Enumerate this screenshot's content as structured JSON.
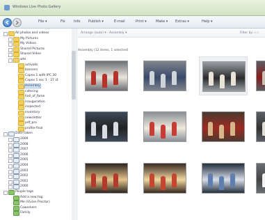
{
  "window": {
    "title": "Windows Live Photo Gallery"
  },
  "toolbar": {
    "items": [
      "File ▾",
      "Fix",
      "Info",
      "Publish ▾",
      "E-mail",
      "Print ▾",
      "Make ▾",
      "Extras ▾",
      "Help ▾"
    ]
  },
  "sidebar": {
    "items": [
      {
        "label": "All photos and videos",
        "icon": "folder-icon"
      },
      {
        "label": "My Pictures",
        "icon": "folder-icon"
      },
      {
        "label": "My Videos",
        "icon": "folder-icon"
      },
      {
        "label": "Shared Pictures",
        "icon": "folder-icon"
      },
      {
        "label": "Shared Video",
        "icon": "folder-icon"
      },
      {
        "label": "wte",
        "icon": "folder-icon"
      },
      {
        "label": "activate",
        "icon": "folder-icon"
      },
      {
        "label": "banners",
        "icon": "folder-icon"
      },
      {
        "label": "Capex 1 with IPC 30",
        "icon": "folder-icon"
      },
      {
        "label": "Capex 1 sec 1 - 27 st",
        "icon": "folder-icon"
      },
      {
        "label": "Assembly",
        "icon": "folder-icon"
      },
      {
        "label": "catering",
        "icon": "folder-icon"
      },
      {
        "label": "hall_of_fame",
        "icon": "folder-icon"
      },
      {
        "label": "inauguration",
        "icon": "folder-icon"
      },
      {
        "label": "inspected",
        "icon": "folder-icon"
      },
      {
        "label": "inventory",
        "icon": "folder-icon"
      },
      {
        "label": "newsletter",
        "icon": "folder-icon"
      },
      {
        "label": "pdf_pro",
        "icon": "folder-icon"
      },
      {
        "label": "profile-final",
        "icon": "folder-icon"
      },
      {
        "label": "Date taken",
        "icon": "calendar-icon"
      },
      {
        "label": "2009",
        "icon": "calendar-icon"
      },
      {
        "label": "2008",
        "icon": "calendar-icon"
      },
      {
        "label": "2007",
        "icon": "calendar-icon"
      },
      {
        "label": "2006",
        "icon": "calendar-icon"
      },
      {
        "label": "2005",
        "icon": "calendar-icon"
      },
      {
        "label": "2004",
        "icon": "calendar-icon"
      },
      {
        "label": "2003",
        "icon": "calendar-icon"
      },
      {
        "label": "2002",
        "icon": "calendar-icon"
      },
      {
        "label": "2001",
        "icon": "calendar-icon"
      },
      {
        "label": "2000",
        "icon": "calendar-icon"
      },
      {
        "label": "People tags",
        "icon": "tag-icon"
      },
      {
        "label": "Add a new tag",
        "icon": "tag-icon"
      },
      {
        "label": "Me (Vivian Proctor)",
        "icon": "tag-icon"
      },
      {
        "label": "Coworkers",
        "icon": "tag-icon"
      },
      {
        "label": "Family",
        "icon": "tag-icon"
      }
    ]
  },
  "main": {
    "sort_label": "Arrange (auto) ▾ · Assembly ▾",
    "filter_label": "Filter by ☆☆",
    "group_label": "Assembly  (12 items, 1 selected)"
  },
  "photos": [
    {
      "name": "photo-1"
    },
    {
      "name": "photo-2"
    },
    {
      "name": "photo-3"
    },
    {
      "name": "photo-4"
    },
    {
      "name": "photo-5"
    },
    {
      "name": "photo-6"
    },
    {
      "name": "photo-7"
    },
    {
      "name": "photo-8"
    },
    {
      "name": "photo-9"
    },
    {
      "name": "photo-10"
    },
    {
      "name": "photo-11"
    },
    {
      "name": "photo-12"
    }
  ]
}
